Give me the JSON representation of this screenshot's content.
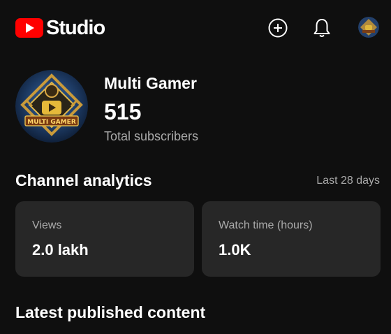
{
  "header": {
    "logo_text": "Studio",
    "icons": [
      "create-icon",
      "notifications-bell-icon",
      "account-avatar"
    ]
  },
  "channel": {
    "name": "Multi Gamer",
    "subscriber_count": "515",
    "subscriber_label": "Total subscribers",
    "avatar_text": "MULTI GAMER"
  },
  "analytics": {
    "title": "Channel analytics",
    "period": "Last 28 days",
    "cards": [
      {
        "label": "Views",
        "value": "2.0 lakh"
      },
      {
        "label": "Watch time (hours)",
        "value": "1.0K"
      }
    ]
  },
  "latest": {
    "title": "Latest published content"
  },
  "colors": {
    "background": "#0f0f0f",
    "card": "#272727",
    "brand_red": "#ff0000",
    "primary_text": "#f1f1f1",
    "secondary_text": "#aaaaaa"
  }
}
